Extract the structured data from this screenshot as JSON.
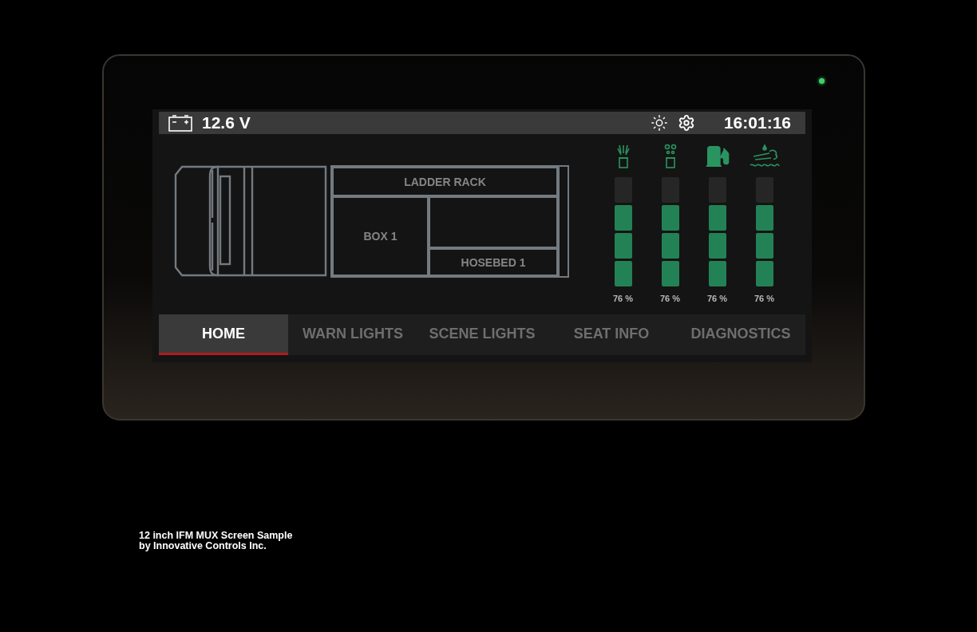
{
  "status_bar": {
    "voltage": "12.6 V",
    "time": "16:01:16"
  },
  "compartments": [
    {
      "label": "LADDER RACK"
    },
    {
      "label": "BOX 1"
    },
    {
      "label": "HOSEBED 1"
    }
  ],
  "gauges": [
    {
      "kind": "water",
      "level": 0.76,
      "reading": "76 %"
    },
    {
      "kind": "foam",
      "level": 0.76,
      "reading": "76 %"
    },
    {
      "kind": "fuel",
      "level": 0.76,
      "reading": "76 %"
    },
    {
      "kind": "def",
      "level": 0.76,
      "reading": "76 %"
    }
  ],
  "tabs": [
    {
      "label": "HOME",
      "selected": true
    },
    {
      "label": "WARN LIGHTS",
      "selected": false
    },
    {
      "label": "SCENE LIGHTS",
      "selected": false
    },
    {
      "label": "SEAT INFO",
      "selected": false
    },
    {
      "label": "DIAGNOSTICS",
      "selected": false
    }
  ],
  "caption": [
    "12 inch IFM MUX Screen Sample",
    "by Innovative Controls Inc."
  ]
}
